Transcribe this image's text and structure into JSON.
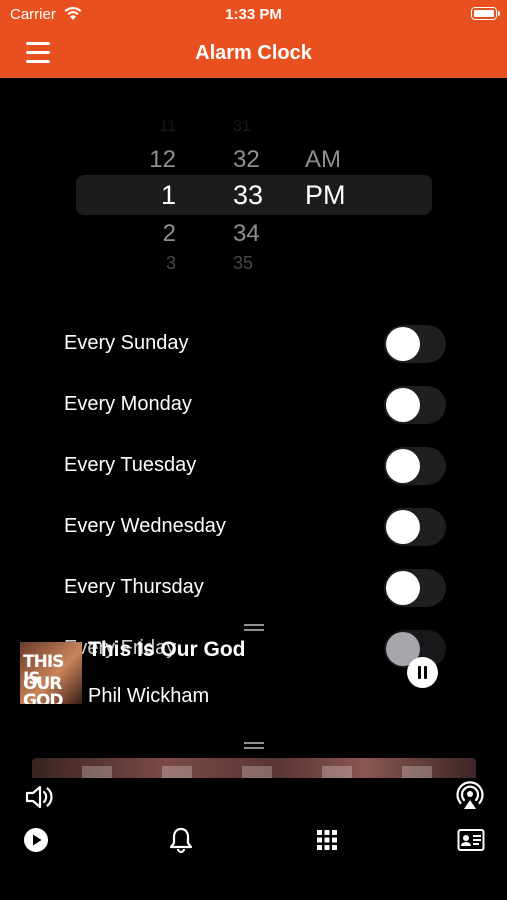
{
  "status_bar": {
    "carrier": "Carrier",
    "time": "1:33 PM"
  },
  "nav_bar": {
    "title": "Alarm Clock",
    "menu_icon": "hamburger-menu-icon"
  },
  "time_picker": {
    "hours": [
      "11",
      "12",
      "1",
      "2",
      "3"
    ],
    "minutes": [
      "31",
      "32",
      "33",
      "34",
      "35"
    ],
    "periods": [
      "AM",
      "PM"
    ],
    "selected": {
      "hour": "1",
      "minute": "33",
      "period": "PM"
    }
  },
  "alarms": [
    {
      "label": "Every Sunday",
      "enabled": false
    },
    {
      "label": "Every Monday",
      "enabled": false
    },
    {
      "label": "Every Tuesday",
      "enabled": false
    },
    {
      "label": "Every Wednesday",
      "enabled": false
    },
    {
      "label": "Every Thursday",
      "enabled": false
    },
    {
      "label": "Every Friday",
      "enabled": false
    }
  ],
  "now_playing": {
    "title": "This Is Our God",
    "artist": "Phil Wickham",
    "cover_text": "THIS IS OUR GOD",
    "state": "playing"
  },
  "bottom_bar": {
    "top_icons": [
      "speaker-icon",
      "airplay-icon"
    ],
    "tabs": [
      "play-circle-icon",
      "bell-icon",
      "grid-icon",
      "contact-card-icon"
    ]
  },
  "colors": {
    "accent": "#e8501f",
    "background": "#000000",
    "toggle_off": "#1f1f21"
  }
}
